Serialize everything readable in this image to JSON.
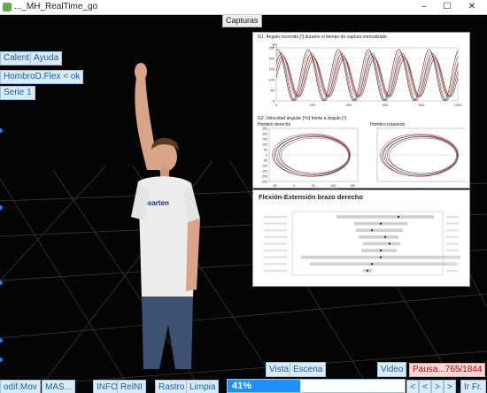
{
  "window": {
    "title": "..._MH_RealTime_go",
    "minimize": "–",
    "maximize": "☐",
    "close": "✕"
  },
  "header": {
    "capturas_label": "Capturas"
  },
  "top_buttons": {
    "calent": "Calent.",
    "ayuda": "Ayuda",
    "movement": "HombroD.Flex < ok",
    "serie": "Serie 1"
  },
  "charts": {
    "g1_title": "G1. Ángulo recorrido [º] durante el tiempo de captura normalizado",
    "g1_ylabel": "[º]",
    "g2_title": "G2. Velocidad angular [º/s] frente a ángulo [º]",
    "g2_left_title": "Hombro derecho",
    "g2_right_title": "Hombro izquierdo",
    "box_title": "Flexión-Extensión brazo derecho"
  },
  "chart_data": [
    {
      "type": "line",
      "title": "G1. Ángulo recorrido [º] durante el tiempo de captura normalizado",
      "ylabel": "[º]",
      "x_ticks": [
        0,
        200,
        400,
        600,
        800,
        1000
      ],
      "y_ticks": [
        0,
        50,
        100,
        150,
        200,
        250
      ],
      "xlim": [
        0,
        1000
      ],
      "ylim": [
        0,
        250
      ]
    },
    {
      "type": "scatter",
      "title": "Hombro derecho",
      "x_ticks": [
        -50,
        0,
        50,
        100,
        150
      ],
      "y_ticks": [
        -250,
        -200,
        -150,
        -100,
        -50,
        0,
        50,
        100,
        150,
        200,
        250
      ]
    },
    {
      "type": "scatter",
      "title": "Hombro izquierdo"
    }
  ],
  "toolbar": {
    "vista": "Vista",
    "escena": "Escena",
    "video": "Video",
    "odif_mov": "odif.Mov",
    "mas": "MAS...",
    "info": "INFO",
    "relni": "RelNI",
    "rastro": "Rastro",
    "limpia": "Limpia",
    "nav_first": "<",
    "nav_prev": "<",
    "nav_next": ">",
    "nav_last": ">",
    "ir_fr": "Ir Fr."
  },
  "progress": {
    "value": 0.41,
    "label": "41%"
  },
  "status": {
    "pause_text": "Pausa...765/1844"
  },
  "colors": {
    "accent": "#1e90ff",
    "button_bg": "#d9ebf7",
    "button_text": "#1a5fa8",
    "pause_text": "#cc0000"
  }
}
